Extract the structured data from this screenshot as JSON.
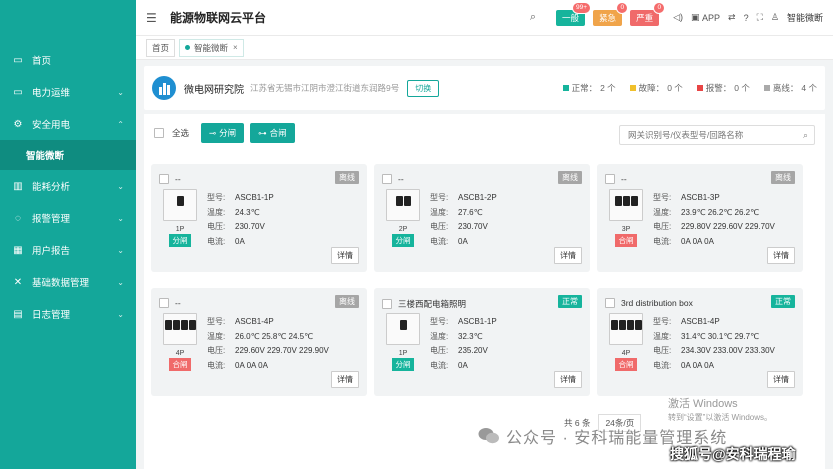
{
  "header": {
    "title": "能源物联网云平台",
    "alarms": [
      {
        "label": "一般",
        "badge": "99+",
        "color": "#16b49c"
      },
      {
        "label": "紧急",
        "badge": "0",
        "color": "#f0a44a"
      },
      {
        "label": "严重",
        "badge": "0",
        "color": "#f06a6a"
      }
    ],
    "app_label": "APP",
    "user_name": "智能微断"
  },
  "sidebar": {
    "items": [
      {
        "label": "首页",
        "icon": "monitor-icon"
      },
      {
        "label": "电力运维",
        "icon": "monitor-icon"
      },
      {
        "label": "安全用电",
        "icon": "gear-icon"
      },
      {
        "label": "智能微断",
        "icon": ""
      },
      {
        "label": "能耗分析",
        "icon": "chart-icon"
      },
      {
        "label": "报警管理",
        "icon": "bell-icon"
      },
      {
        "label": "用户报告",
        "icon": "grid-icon"
      },
      {
        "label": "基础数据管理",
        "icon": "cross-icon"
      },
      {
        "label": "日志管理",
        "icon": "doc-icon"
      }
    ]
  },
  "tabs": [
    {
      "label": "首页"
    },
    {
      "label": "智能微断"
    }
  ],
  "org": {
    "name": "微电网研究院",
    "address": "江苏省无锡市江阴市澄江街道东润路9号",
    "switch_label": "切换",
    "stats": [
      {
        "label": "正常：",
        "value": "2 个",
        "color": "#16b49c"
      },
      {
        "label": "故障：",
        "value": "0 个",
        "color": "#f0c02c"
      },
      {
        "label": "报警：",
        "value": "0 个",
        "color": "#e84545"
      },
      {
        "label": "离线：",
        "value": "4 个",
        "color": "#aaaaaa"
      }
    ]
  },
  "toolbar": {
    "select_all": "全选",
    "open_btn": "分闸",
    "close_btn": "合闸",
    "search_placeholder": "网关识别号/仪表型号/回路名称"
  },
  "cards": [
    {
      "name": "--",
      "status": "离线",
      "online": false,
      "poles": 1,
      "pole_label": "1P",
      "switch": "分闸",
      "switch_on": true,
      "model": "ASCB1-1P",
      "temp": "24.3℃",
      "voltage": "230.70V",
      "current": "0A"
    },
    {
      "name": "--",
      "status": "离线",
      "online": false,
      "poles": 2,
      "pole_label": "2P",
      "switch": "分闸",
      "switch_on": true,
      "model": "ASCB1-2P",
      "temp": "27.6℃",
      "voltage": "230.70V",
      "current": "0A"
    },
    {
      "name": "--",
      "status": "离线",
      "online": false,
      "poles": 3,
      "pole_label": "3P",
      "switch": "合闸",
      "switch_on": false,
      "model": "ASCB1-3P",
      "temp": "23.9℃ 26.2℃ 26.2℃",
      "voltage": "229.80V 229.60V 229.70V",
      "current": "0A 0A 0A"
    },
    {
      "name": "--",
      "status": "离线",
      "online": false,
      "poles": 4,
      "pole_label": "4P",
      "switch": "合闸",
      "switch_on": false,
      "model": "ASCB1-4P",
      "temp": "26.0℃ 25.8℃ 24.5℃",
      "voltage": "229.60V 229.70V 229.90V",
      "current": "0A 0A 0A"
    },
    {
      "name": "三楼西配电箱照明",
      "status": "正常",
      "online": true,
      "poles": 1,
      "pole_label": "1P",
      "switch": "分闸",
      "switch_on": true,
      "model": "ASCB1-1P",
      "temp": "32.3℃",
      "voltage": "235.20V",
      "current": "0A"
    },
    {
      "name": "3rd distribution box",
      "status": "正常",
      "online": true,
      "poles": 4,
      "pole_label": "4P",
      "switch": "合闸",
      "switch_on": false,
      "model": "ASCB1-4P",
      "temp": "31.4℃ 30.1℃ 29.7℃",
      "voltage": "234.30V 233.00V 233.30V",
      "current": "0A 0A 0A"
    }
  ],
  "spec_labels": {
    "model": "型号:",
    "temp": "温度:",
    "voltage": "电压:",
    "current": "电流:"
  },
  "detail_label": "详情",
  "pager": {
    "total": "共 6 条",
    "page_size": "24条/页"
  },
  "watermarks": {
    "win_title": "激活 Windows",
    "win_sub": "转到“设置”以激活 Windows。",
    "wechat": "公众号 · 安科瑞能量管理系统",
    "sohu": "搜狐号@安科瑞程瑜"
  }
}
